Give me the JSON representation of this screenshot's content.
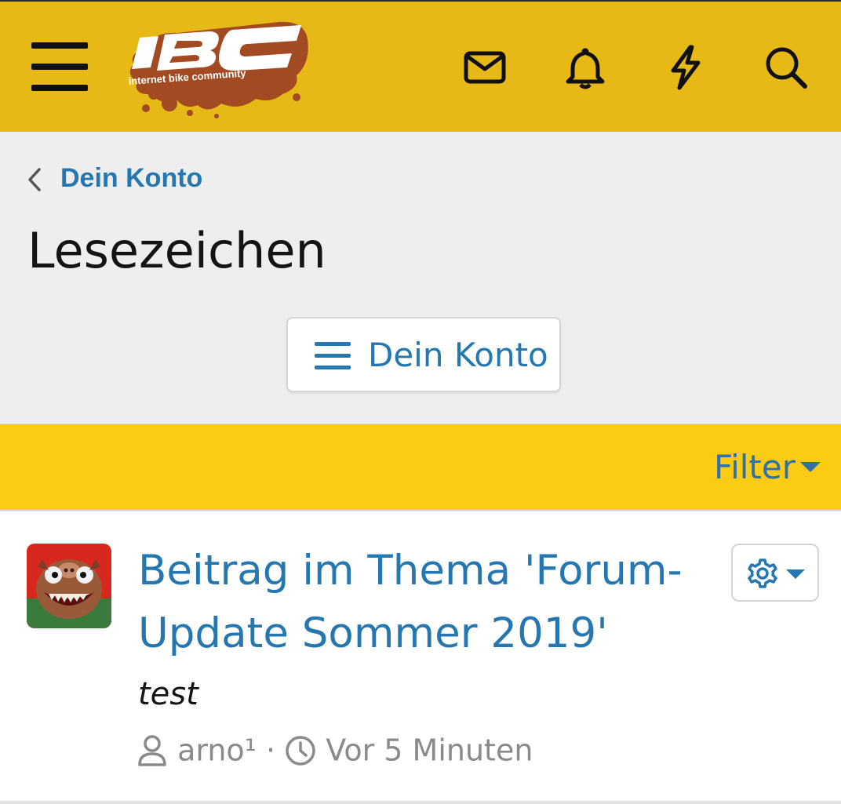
{
  "header": {
    "logo_text": "IBC",
    "logo_tagline": "internet bike community",
    "icons": [
      "menu-icon",
      "mail-icon",
      "bell-icon",
      "lightning-icon",
      "search-icon"
    ],
    "brand_color": "#e6b916"
  },
  "breadcrumb": {
    "link_label": "Dein Konto"
  },
  "page": {
    "title": "Lesezeichen",
    "account_button_label": "Dein Konto"
  },
  "filterbar": {
    "filter_label": "Filter",
    "bar_color": "#fbcb16"
  },
  "bookmark": {
    "title": "Beitrag im Thema 'Forum-Update Sommer 2019'",
    "snippet": "test",
    "author": "arno¹",
    "separator": "·",
    "time": "Vor 5 Minuten",
    "link_color": "#2577b1"
  }
}
